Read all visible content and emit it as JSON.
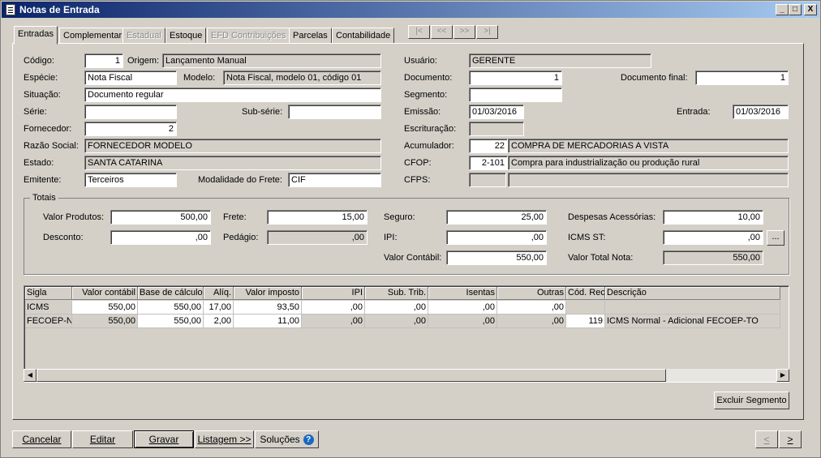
{
  "window": {
    "title": "Notas de Entrada",
    "min": "_",
    "max": "□",
    "close": "X"
  },
  "tabs": [
    "Entradas",
    "Complementar",
    "Estadual",
    "Estoque",
    "EFD Contribuições",
    "Parcelas",
    "Contabilidade"
  ],
  "nav": [
    "|<",
    "<<",
    ">>",
    ">|"
  ],
  "form": {
    "codigo_label": "Código:",
    "codigo": "1",
    "origem_label": "Origem:",
    "origem": "Lançamento Manual",
    "usuario_label": "Usuário:",
    "usuario": "GERENTE",
    "especie_label": "Espécie:",
    "especie": "Nota Fiscal",
    "modelo_label": "Modelo:",
    "modelo": "Nota Fiscal, modelo 01, código 01",
    "documento_label": "Documento:",
    "documento": "1",
    "docfinal_label": "Documento final:",
    "docfinal": "1",
    "situacao_label": "Situação:",
    "situacao": "Documento regular",
    "segmento_label": "Segmento:",
    "segmento": "",
    "serie_label": "Série:",
    "serie": "",
    "subserie_label": "Sub-série:",
    "subserie": "",
    "emissao_label": "Emissão:",
    "emissao": "01/03/2016",
    "entrada_label": "Entrada:",
    "entrada": "01/03/2016",
    "fornecedor_label": "Fornecedor:",
    "fornecedor": "2",
    "escrituracao_label": "Escrituração:",
    "escrituracao": "",
    "razao_label": "Razão Social:",
    "razao": "FORNECEDOR MODELO",
    "acumulador_label": "Acumulador:",
    "acumulador": "22",
    "acumulador_desc": "COMPRA DE MERCADORIAS A VISTA",
    "estado_label": "Estado:",
    "estado": "SANTA CATARINA",
    "cfop_label": "CFOP:",
    "cfop": "2-101",
    "cfop_desc": "Compra para industrialização ou produção rural",
    "emitente_label": "Emitente:",
    "emitente": "Terceiros",
    "frete_mod_label": "Modalidade do Frete:",
    "frete_mod": "CIF",
    "cfps_label": "CFPS:",
    "cfps": "",
    "cfps_desc": ""
  },
  "totais": {
    "title": "Totais",
    "valor_produtos_label": "Valor Produtos:",
    "valor_produtos": "500,00",
    "frete_label": "Frete:",
    "frete": "15,00",
    "seguro_label": "Seguro:",
    "seguro": "25,00",
    "despesas_label": "Despesas Acessórias:",
    "despesas": "10,00",
    "desconto_label": "Desconto:",
    "desconto": ",00",
    "pedagio_label": "Pedágio:",
    "pedagio": ",00",
    "ipi_label": "IPI:",
    "ipi": ",00",
    "icms_st_label": "ICMS ST:",
    "icms_st": ",00",
    "ellipsis": "...",
    "valor_contabil_label": "Valor Contábil:",
    "valor_contabil": "550,00",
    "valor_total_label": "Valor Total Nota:",
    "valor_total": "550,00"
  },
  "grid": {
    "headers": [
      "Sigla",
      "Valor contábil",
      "Base de cálculo",
      "Alíq.",
      "Valor imposto",
      "IPI",
      "Sub. Trib.",
      "Isentas",
      "Outras",
      "Cód. Rec.",
      "Descrição"
    ],
    "rows": [
      [
        "ICMS",
        "550,00",
        "550,00",
        "17,00",
        "93,50",
        ",00",
        ",00",
        ",00",
        ",00",
        "",
        ""
      ],
      [
        "FECOEP-N",
        "550,00",
        "550,00",
        "2,00",
        "11,00",
        ",00",
        ",00",
        ",00",
        ",00",
        "119",
        "ICMS Normal - Adicional FECOEP-TO"
      ]
    ]
  },
  "buttons": {
    "excluir": "Excluir Segmento",
    "cancelar": "Cancelar",
    "editar": "Editar",
    "gravar": "Gravar",
    "listagem": "Listagem >>",
    "solucoes": "Soluções",
    "help_icon": "?",
    "prev": "<",
    "next": ">"
  }
}
